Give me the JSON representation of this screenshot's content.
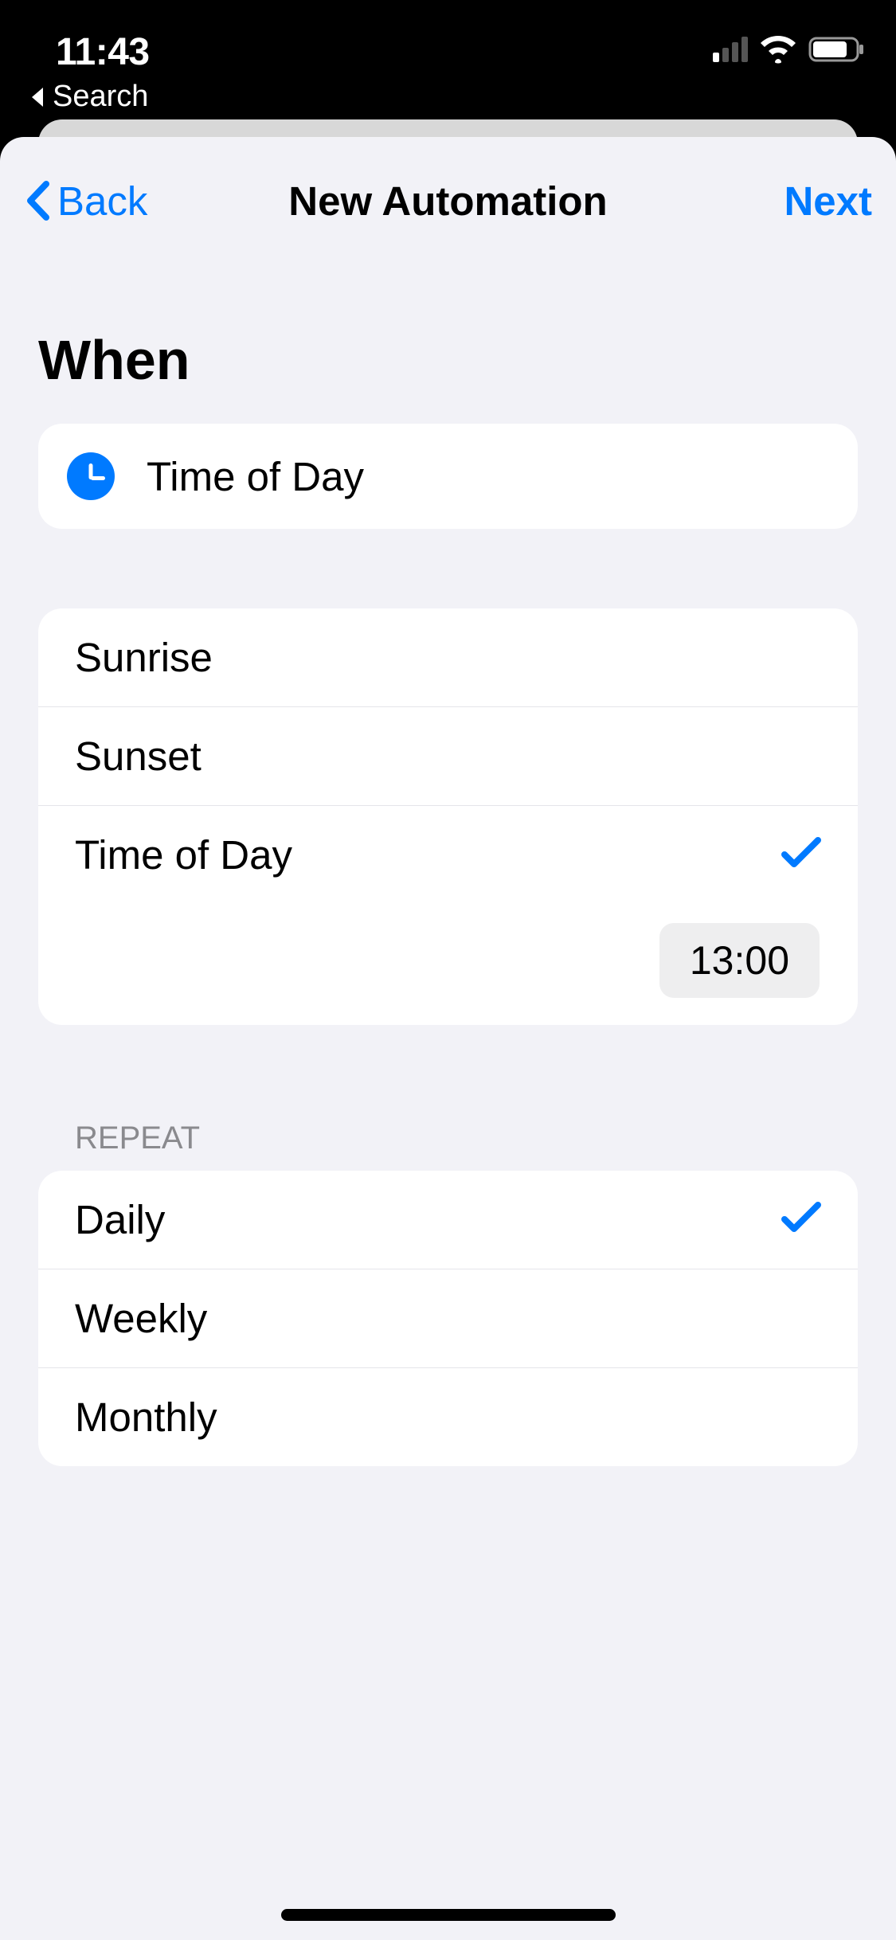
{
  "status": {
    "time": "11:43",
    "breadcrumb": "Search"
  },
  "nav": {
    "back": "Back",
    "title": "New Automation",
    "next": "Next"
  },
  "section": {
    "when": "When",
    "repeat": "REPEAT"
  },
  "trigger": {
    "label": "Time of Day"
  },
  "timeOptions": [
    {
      "label": "Sunrise",
      "selected": false
    },
    {
      "label": "Sunset",
      "selected": false
    },
    {
      "label": "Time of Day",
      "selected": true
    }
  ],
  "timeValue": "13:00",
  "repeatOptions": [
    {
      "label": "Daily",
      "selected": true
    },
    {
      "label": "Weekly",
      "selected": false
    },
    {
      "label": "Monthly",
      "selected": false
    }
  ]
}
